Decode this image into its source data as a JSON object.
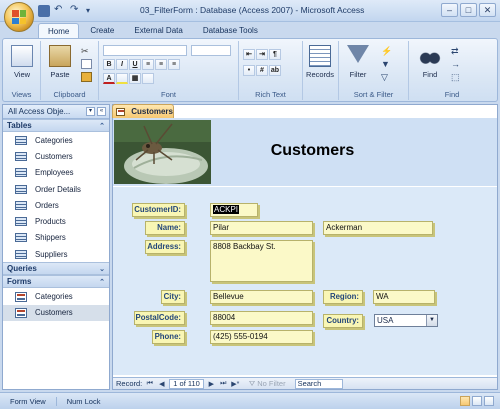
{
  "window": {
    "title": "03_FilterForm : Database (Access 2007) - Microsoft Access",
    "controls": [
      "–",
      "□",
      "✕"
    ]
  },
  "ribbon": {
    "tabs": [
      "Home",
      "Create",
      "External Data",
      "Database Tools"
    ],
    "active_tab": "Home",
    "groups": {
      "views": {
        "label": "Views",
        "view_button": "View"
      },
      "clipboard": {
        "label": "Clipboard",
        "paste_button": "Paste"
      },
      "font": {
        "label": "Font",
        "bold": "B",
        "italic": "I",
        "underline": "U"
      },
      "rich_text": {
        "label": "Rich Text"
      },
      "records": {
        "label": "Records",
        "records_button": "Records"
      },
      "sort_filter": {
        "label": "Sort & Filter",
        "filter_button": "Filter"
      },
      "find": {
        "label": "Find",
        "find_button": "Find"
      }
    }
  },
  "nav_pane": {
    "header": "All Access Obje...",
    "sections": {
      "tables": {
        "label": "Tables",
        "items": [
          "Categories",
          "Customers",
          "Employees",
          "Order Details",
          "Orders",
          "Products",
          "Shippers",
          "Suppliers"
        ]
      },
      "queries": {
        "label": "Queries"
      },
      "forms": {
        "label": "Forms",
        "items": [
          "Categories",
          "Customers"
        ],
        "selected": "Customers"
      }
    }
  },
  "document": {
    "tab_label": "Customers",
    "form_title": "Customers",
    "fields": {
      "customer_id": {
        "label": "CustomerID:",
        "value": "ACKPI"
      },
      "name": {
        "label": "Name:",
        "first": "Pilar",
        "last": "Ackerman"
      },
      "address": {
        "label": "Address:",
        "value": "8808 Backbay St."
      },
      "city": {
        "label": "City:",
        "value": "Bellevue"
      },
      "region": {
        "label": "Region:",
        "value": "WA"
      },
      "postal_code": {
        "label": "PostalCode:",
        "value": "88004"
      },
      "country": {
        "label": "Country:",
        "value": "USA"
      },
      "phone": {
        "label": "Phone:",
        "value": "(425) 555-0194"
      }
    },
    "record_nav": {
      "label": "Record:",
      "position": "1 of 110",
      "filter": "No Filter",
      "search": "Search"
    }
  },
  "status_bar": {
    "left": "Form View",
    "right": "Num Lock"
  }
}
